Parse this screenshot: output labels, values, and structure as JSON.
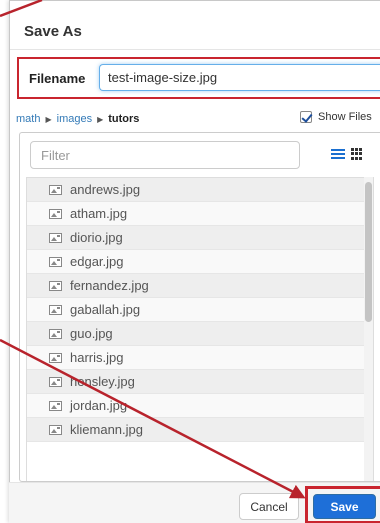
{
  "dialog": {
    "title": "Save As",
    "filename_label": "Filename",
    "filename_value": "test-image-size.jpg"
  },
  "breadcrumb": {
    "items": [
      "math",
      "images"
    ],
    "current": "tutors"
  },
  "show_files": {
    "label": "Show Files",
    "checked": true
  },
  "filter": {
    "placeholder": "Filter"
  },
  "files": [
    "andrews.jpg",
    "atham.jpg",
    "diorio.jpg",
    "edgar.jpg",
    "fernandez.jpg",
    "gaballah.jpg",
    "guo.jpg",
    "harris.jpg",
    "hensley.jpg",
    "jordan.jpg",
    "kliemann.jpg"
  ],
  "footer": {
    "cancel_label": "Cancel",
    "save_label": "Save"
  },
  "colors": {
    "annotation": "#c9252f",
    "primary": "#1e6fd8",
    "link": "#337ab7"
  }
}
